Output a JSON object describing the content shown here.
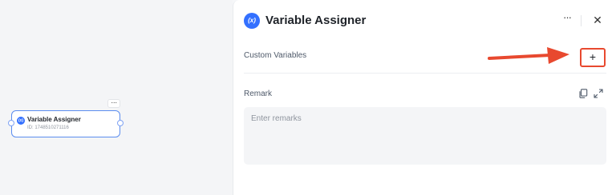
{
  "canvas": {
    "node": {
      "title": "Variable Assigner",
      "id_text": "ID: 1748510271116",
      "more_glyph": "···",
      "icon": "variable-x-icon"
    }
  },
  "panel": {
    "title": "Variable Assigner",
    "icon": "variable-x-icon",
    "icon_glyph": "(x)",
    "more_glyph": "···",
    "close_glyph": "✕",
    "custom_variables": {
      "label": "Custom Variables",
      "add_glyph": "+"
    },
    "remark": {
      "label": "Remark",
      "placeholder": "Enter remarks",
      "value": ""
    }
  },
  "colors": {
    "accent": "#3370ff",
    "node_border": "#5b8def",
    "annotation_red": "#e8492f"
  }
}
